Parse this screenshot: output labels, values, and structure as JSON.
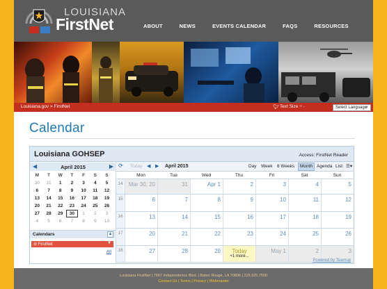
{
  "brand": {
    "logo_top": "LOUISIANA",
    "logo_main": "FirstNet"
  },
  "nav": [
    "ABOUT",
    "NEWS",
    "EVENTS CALENDAR",
    "FAQS",
    "RESOURCES"
  ],
  "utility": {
    "breadcrumb": "Louisiana.gov > FirstNet",
    "text_size": "Text Size",
    "text_size_symbols": "+ -",
    "language": "Select Language"
  },
  "page_title": "Calendar",
  "calendar": {
    "name": "Louisiana GOHSEP",
    "access": "Access: FirstNet Reader",
    "mini": {
      "month": "April 2015",
      "weekdays": [
        "M",
        "T",
        "W",
        "T",
        "F",
        "S",
        "S"
      ],
      "weeks": [
        [
          "30",
          "31",
          "1",
          "2",
          "3",
          "4",
          "5"
        ],
        [
          "6",
          "7",
          "8",
          "9",
          "10",
          "11",
          "12"
        ],
        [
          "13",
          "14",
          "15",
          "16",
          "17",
          "18",
          "19"
        ],
        [
          "20",
          "21",
          "22",
          "23",
          "24",
          "25",
          "26"
        ],
        [
          "27",
          "28",
          "29",
          "30",
          "1",
          "2",
          "3"
        ],
        [
          "4",
          "5",
          "6",
          "7",
          "8",
          "9",
          "10"
        ]
      ]
    },
    "calendars_label": "Calendars",
    "calendar_chip": "FirstNet",
    "all_link": "All",
    "toolbar": {
      "today": "Today",
      "range": "April 2015",
      "views": [
        "Day",
        "Week",
        "8 Weeks",
        "Month",
        "Agenda",
        "List"
      ],
      "active_view": "Month"
    },
    "day_headers": [
      "Mon",
      "Tue",
      "Wed",
      "Thu",
      "Fri",
      "Sat",
      "Sun"
    ],
    "weeks": [
      {
        "num": "14",
        "days": [
          "Mar 30, 20",
          "31",
          "Apr 1",
          "2",
          "3",
          "4",
          "5"
        ]
      },
      {
        "num": "15",
        "days": [
          "6",
          "7",
          "8",
          "9",
          "10",
          "11",
          "12"
        ]
      },
      {
        "num": "16",
        "days": [
          "13",
          "14",
          "15",
          "16",
          "17",
          "18",
          "19"
        ]
      },
      {
        "num": "17",
        "days": [
          "20",
          "21",
          "22",
          "23",
          "24",
          "25",
          "26"
        ]
      },
      {
        "num": "18",
        "days": [
          "27",
          "28",
          "29",
          "Today",
          "May 1",
          "2",
          "3"
        ]
      }
    ],
    "today_more": "+1 more...",
    "powered_by": "Powered by Teamup"
  },
  "footer": {
    "address": "Louisiana FirstNet | 7667 Independence Blvd. | Baton Rouge, LA 70806 | 225.925.7500",
    "links": "Contact Us | Terms | Privacy | Webmaster"
  },
  "colors": {
    "frame": "#f7b51b",
    "header": "#5a5a5a",
    "accent_red": "#c42e1e",
    "title_blue": "#1f7bb5",
    "calendar_head": "#dfe9f4"
  }
}
